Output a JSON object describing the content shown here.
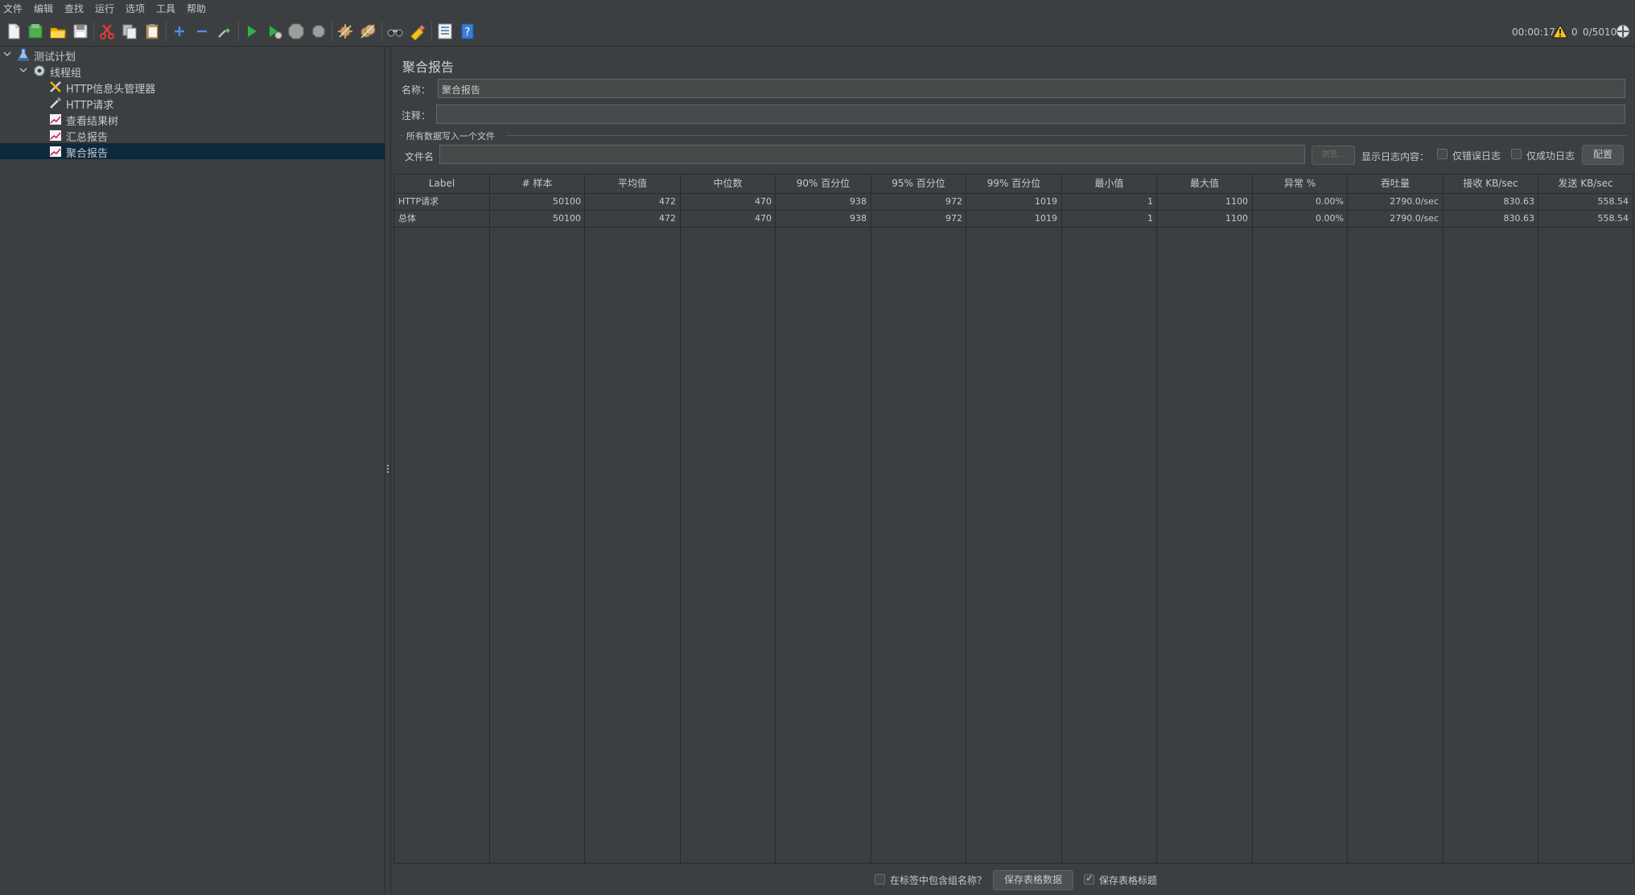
{
  "menu": [
    "文件",
    "编辑",
    "查找",
    "运行",
    "选项",
    "工具",
    "帮助"
  ],
  "status": {
    "timer": "00:00:17",
    "warnings": "0",
    "threads": "0/5010"
  },
  "tree": {
    "items": [
      {
        "label": "测试计划",
        "icon": "flask-icon"
      },
      {
        "label": "线程组",
        "icon": "gear-icon"
      },
      {
        "label": "HTTP信息头管理器",
        "icon": "tools-icon"
      },
      {
        "label": "HTTP请求",
        "icon": "pipette-icon"
      },
      {
        "label": "查看结果树",
        "icon": "chart-icon"
      },
      {
        "label": "汇总报告",
        "icon": "chart-icon"
      },
      {
        "label": "聚合报告",
        "icon": "chart-icon"
      }
    ]
  },
  "panel": {
    "title": "聚合报告",
    "name_label": "名称：",
    "name_value": "聚合报告",
    "comment_label": "注释：",
    "comment_value": "",
    "group_title": "所有数据写入一个文件",
    "file_label": "文件名",
    "file_value": "",
    "browse_label": "浏览...",
    "log_label": "显示日志内容：",
    "errors_only_label": "仅错误日志",
    "success_only_label": "仅成功日志",
    "config_label": "配置"
  },
  "table": {
    "columns": [
      "Label",
      "# 样本",
      "平均值",
      "中位数",
      "90% 百分位",
      "95% 百分位",
      "99% 百分位",
      "最小值",
      "最大值",
      "异常 %",
      "吞吐量",
      "接收 KB/sec",
      "发送 KB/sec"
    ],
    "rows": [
      [
        "HTTP请求",
        "50100",
        "472",
        "470",
        "938",
        "972",
        "1019",
        "1",
        "1100",
        "0.00%",
        "2790.0/sec",
        "830.63",
        "558.54"
      ],
      [
        "总体",
        "50100",
        "472",
        "470",
        "938",
        "972",
        "1019",
        "1",
        "1100",
        "0.00%",
        "2790.0/sec",
        "830.63",
        "558.54"
      ]
    ]
  },
  "bottom": {
    "include_group_label": "在标签中包含组名称？",
    "save_data_label": "保存表格数据",
    "save_header_label": "保存表格标题"
  }
}
